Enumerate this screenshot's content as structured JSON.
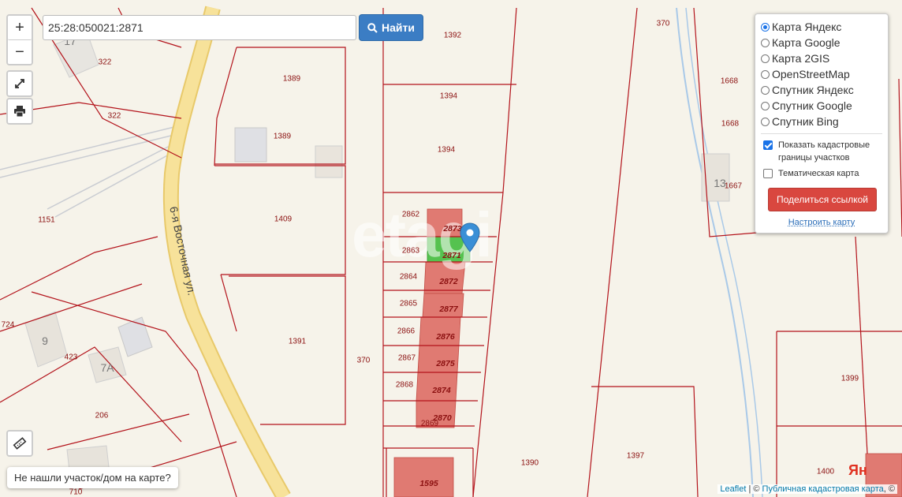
{
  "search": {
    "value": "25:28:050021:2871",
    "button_label": "Найти"
  },
  "zoom": {
    "in_label": "+",
    "out_label": "−"
  },
  "layers": {
    "base_options": [
      {
        "label": "Карта Яндекс",
        "selected": true
      },
      {
        "label": "Карта Google",
        "selected": false
      },
      {
        "label": "Карта 2GIS",
        "selected": false
      },
      {
        "label": "OpenStreetMap",
        "selected": false
      },
      {
        "label": "Спутник Яндекс",
        "selected": false
      },
      {
        "label": "Спутник Google",
        "selected": false
      },
      {
        "label": "Спутник Bing",
        "selected": false
      }
    ],
    "cadastral_label": "Показать кадастровые границы участков",
    "cadastral_checked": true,
    "thematic_label": "Тематическая карта",
    "thematic_checked": false,
    "share_label": "Поделиться ссылкой",
    "setup_label": "Настроить карту"
  },
  "not_found_label": "Не нашли участок/дом на карте?",
  "attribution": {
    "leaflet": "Leaflet",
    "separator": " | © ",
    "cadastral": "Публичная кадастровая карта",
    "suffix": ", ©"
  },
  "street_label": "6-я Восточная ул.",
  "watermark": "etagi",
  "yandex_logo": "Ян",
  "plot_labels": [
    "1392",
    "1394",
    "1394",
    "1389",
    "1389",
    "1409",
    "1391",
    "1151",
    "322",
    "322",
    "724",
    "423",
    "206",
    "710",
    "370",
    "370",
    "2862",
    "2863",
    "2864",
    "2865",
    "2866",
    "2867",
    "2868",
    "2869",
    "1390",
    "1397",
    "1399",
    "1400",
    "1668",
    "1668",
    "1667"
  ],
  "parcel_labels": [
    "2873",
    "2871",
    "2872",
    "2877",
    "2876",
    "2875",
    "2874",
    "2870",
    "1595"
  ],
  "house_numbers": [
    "9",
    "7А",
    "17",
    "13"
  ],
  "colors": {
    "parcel_fill": "#e07a72",
    "selected_fill": "#55c24f",
    "boundary": "#b3131b",
    "road": "#f6dc8c",
    "button": "#3b7dc4",
    "share": "#d9473f"
  }
}
